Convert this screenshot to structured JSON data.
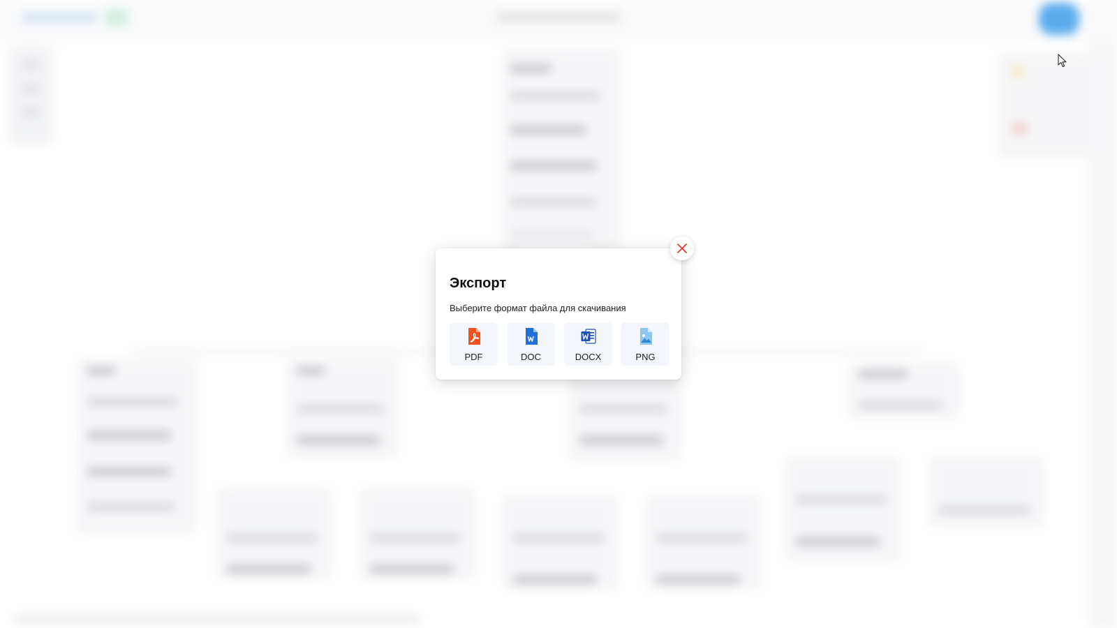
{
  "dialog": {
    "title": "Экспорт",
    "subtitle": "Выберите формат файла для скачивания",
    "formats": [
      {
        "label": "PDF",
        "icon": "pdf-icon",
        "color": "#f4511e"
      },
      {
        "label": "DOC",
        "icon": "doc-icon",
        "color": "#1e6fd9"
      },
      {
        "label": "DOCX",
        "icon": "docx-icon",
        "color": "#1e4fb3"
      },
      {
        "label": "PNG",
        "icon": "png-icon",
        "color": "#5aa9e6"
      }
    ],
    "close_icon": "close-icon",
    "close_color": "#e53935"
  },
  "colors": {
    "accent": "#4aa3ec",
    "format_button_bg": "#f3f7fc"
  }
}
